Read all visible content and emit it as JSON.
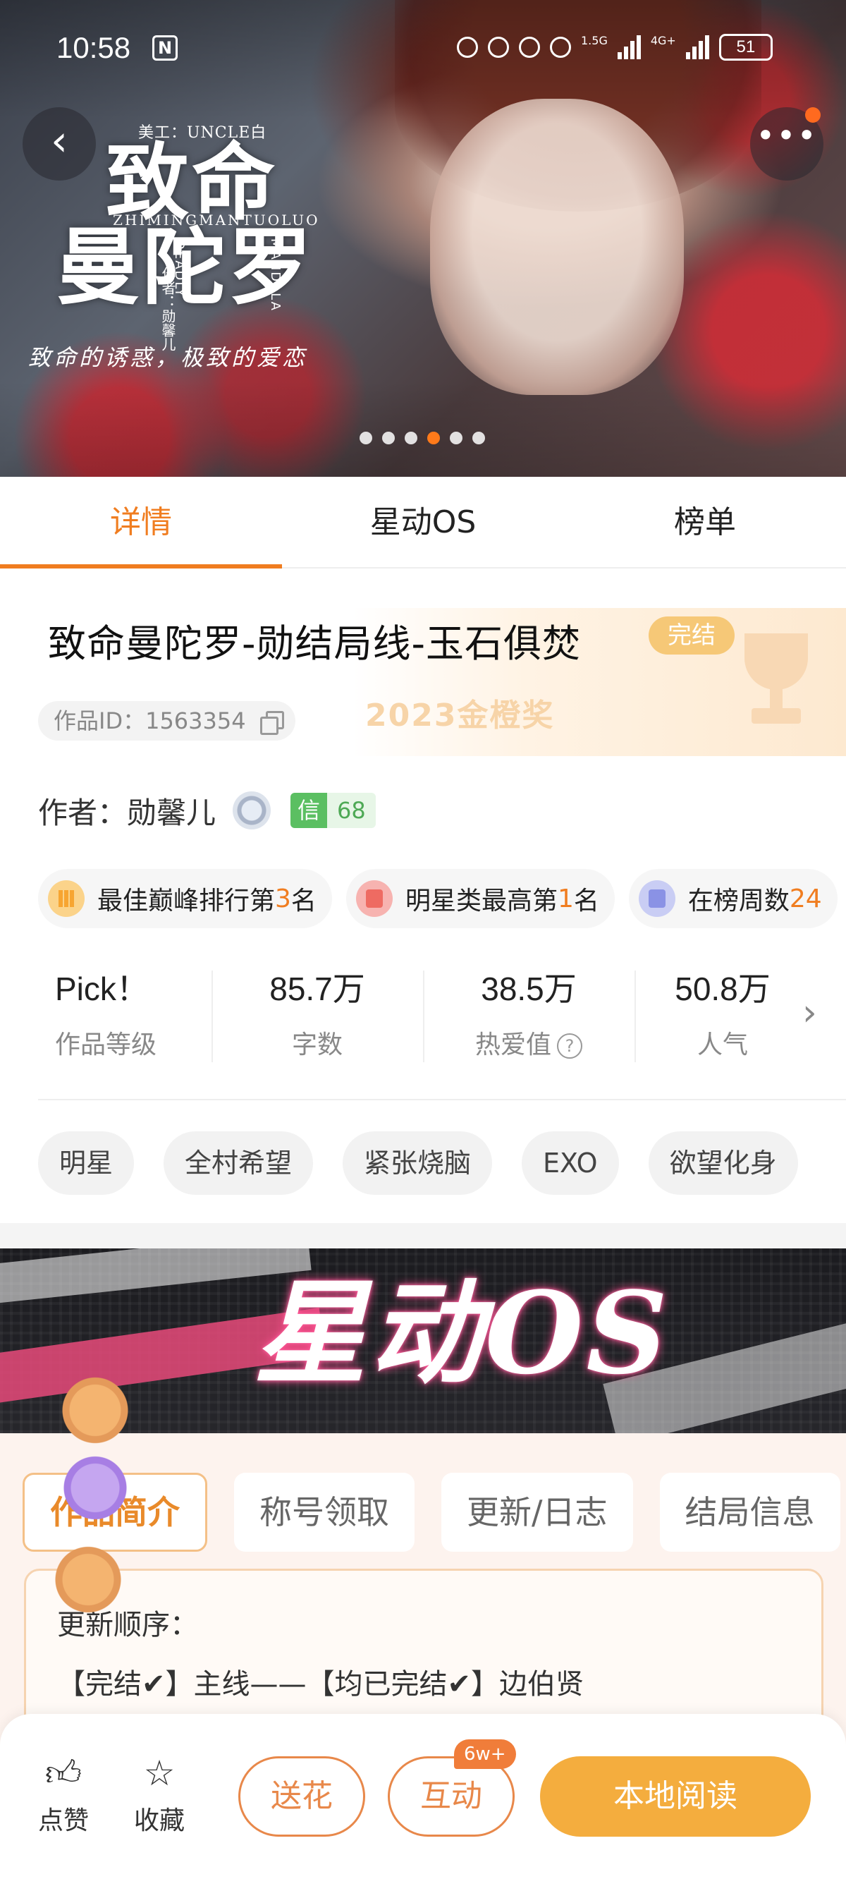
{
  "status_bar": {
    "time": "10:58",
    "nfc": "N",
    "net1": "1.5G",
    "net2": "4G+",
    "battery": "51"
  },
  "banner": {
    "credit": "美工：UNCLE白",
    "title_line1": "致命",
    "title_line2": "曼陀罗",
    "pinyin": "ZHIMINGMANTUOLUO",
    "deadly": "DEADLY",
    "mandala": "MANDALA",
    "author_credit": "作者：勋馨儿",
    "tagline": "致命的诱惑，极致的爱恋",
    "page_count": 6,
    "active_page": 4,
    "back_icon": "back-arrow-icon",
    "more_icon": "more-dots-icon"
  },
  "tabs": [
    "详情",
    "星动OS",
    "榜单"
  ],
  "book": {
    "title": "致命曼陀罗-勋结局线-玉石俱焚",
    "status": "完结",
    "id_text": "作品ID：1563354",
    "award": "2023金橙奖"
  },
  "author": {
    "label": "作者：",
    "name": "勋馨儿",
    "trust_label": "信",
    "trust_value": "68"
  },
  "honors": [
    {
      "prefix": "最佳巅峰排行第",
      "num": "3",
      "suffix": "名"
    },
    {
      "prefix": "明星类最高第",
      "num": "1",
      "suffix": "名"
    },
    {
      "prefix": "在榜周数",
      "num": "24",
      "suffix": ""
    }
  ],
  "stats": [
    {
      "value": "Pick！",
      "label": "作品等级"
    },
    {
      "value": "85.7万",
      "label": "字数"
    },
    {
      "value": "38.5万",
      "label": "热爱值"
    },
    {
      "value": "50.8万",
      "label": "人气"
    }
  ],
  "tags": [
    "明星",
    "全村希望",
    "紧张烧脑",
    "EXO",
    "欲望化身"
  ],
  "os_banner": {
    "title": "星动OS"
  },
  "sub_tabs": [
    "作品简介",
    "称号领取",
    "更新/日志",
    "结局信息"
  ],
  "intro": {
    "line1": "更新顺序：",
    "line2": "【完结✔】主线——【均已完结✔】边伯贤"
  },
  "bottom_bar": {
    "like": "点赞",
    "favorite": "收藏",
    "gift": "送花",
    "interact": "互动",
    "interact_count": "6w+",
    "read": "本地阅读"
  },
  "colors": {
    "accent": "#f07d20",
    "read_button": "#f4ad3e",
    "finished_badge": "#f6c877",
    "trust_green": "#5bbf62"
  }
}
